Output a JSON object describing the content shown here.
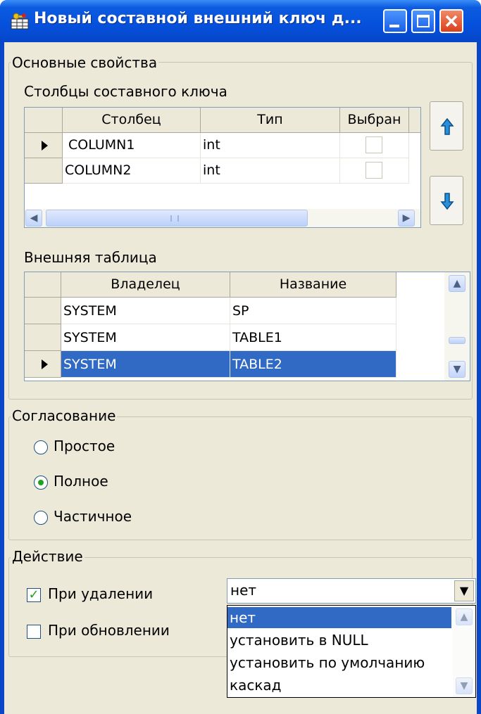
{
  "window": {
    "title": "Новый составной внешний ключ д...",
    "accent": "#0550dc"
  },
  "basic_props": {
    "group_title": "Основные свойства",
    "columns_label": "Столбцы составного ключа",
    "columns_grid": {
      "headers": [
        "Столбец",
        "Тип",
        "Выбран"
      ],
      "rows": [
        {
          "column": "COLUMN1",
          "type": "int",
          "current": true,
          "checked": false
        },
        {
          "column": "COLUMN2",
          "type": "int",
          "current": false,
          "checked": false
        }
      ]
    },
    "up_icon": "arrow-up-icon",
    "down_icon": "arrow-down-icon",
    "foreign_table_label": "Внешняя таблица",
    "foreign_grid": {
      "headers": [
        "Владелец",
        "Название"
      ],
      "rows": [
        {
          "owner": "SYSTEM",
          "name": "SP"
        },
        {
          "owner": "SYSTEM",
          "name": "TABLE1"
        },
        {
          "owner": "SYSTEM",
          "name": "TABLE2"
        }
      ],
      "selected_index": 2
    }
  },
  "match": {
    "group_title": "Согласование",
    "options": [
      "Простое",
      "Полное",
      "Частичное"
    ],
    "selected": "Полное"
  },
  "action": {
    "group_title": "Действие",
    "on_delete": {
      "label": "При удалении",
      "checked": true
    },
    "on_update": {
      "label": "При обновлении",
      "checked": false
    },
    "combo_value": "нет",
    "options": [
      "нет",
      "установить в NULL",
      "установить по умолчанию",
      "каскад"
    ],
    "selected_option": "нет",
    "selection_color": "#316ac5"
  }
}
